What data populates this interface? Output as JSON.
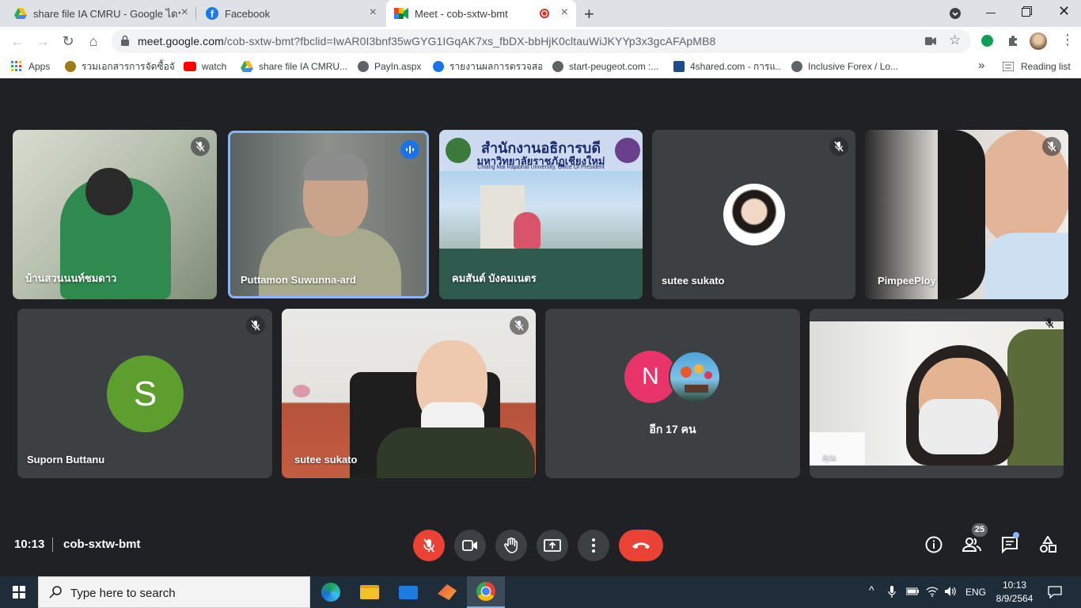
{
  "browser": {
    "tabs": [
      {
        "title": "share file IA CMRU - Google ไดรฟ์",
        "close": "×"
      },
      {
        "title": "Facebook",
        "close": "×"
      },
      {
        "title": "Meet - cob-sxtw-bmt",
        "close": "×"
      }
    ],
    "new_tab": "+",
    "url_domain": "meet.google.com",
    "url_path": "/cob-sxtw-bmt?fbclid=IwAR0I3bnf35wGYG1IGqAK7xs_fbDX-bbHjK0cltauWiJKYYp3x3gcAFApMB8",
    "bookmarks": [
      {
        "label": "Apps",
        "color": "#4285f4"
      },
      {
        "label": "รวมเอกสารการจัดซื้อจั...",
        "color": "#9e7b17"
      },
      {
        "label": "watch",
        "color": "#ff0000"
      },
      {
        "label": "share file IA CMRU...",
        "color": "#34a853"
      },
      {
        "label": "PayIn.aspx",
        "color": "#5f6368"
      },
      {
        "label": "รายงานผลการตรวจสอ...",
        "color": "#1a73e8"
      },
      {
        "label": "start-peugeot.com :...",
        "color": "#5f6368"
      },
      {
        "label": "4shared.com - การแ...",
        "color": "#1c4d8a"
      },
      {
        "label": "Inclusive Forex / Lo...",
        "color": "#5f6368"
      }
    ],
    "more_bookmarks": "»",
    "reading_list": "Reading list"
  },
  "participants": [
    {
      "name": "บ้านสวนนนท์ชมดาว",
      "muted": true
    },
    {
      "name": "Puttamon Suwunna-ard",
      "speaking": true
    },
    {
      "name": "คมสันต์ บังคมเนตร",
      "muted": false,
      "banner_title": "สำนักงานอธิการบดี",
      "banner_subtitle": "มหาวิทยาลัยราชภัฏเชียงใหม่",
      "banner_caption": "Chiang Mai Rajabhat University, Office Of President"
    },
    {
      "name": "sutee sukato",
      "muted": true
    },
    {
      "name": "PimpeePloy",
      "muted": true
    },
    {
      "name": "Suporn Buttanu",
      "muted": true,
      "initial": "S",
      "avatar_color": "#5e9e2f"
    },
    {
      "name": "sutee sukato",
      "muted": true
    },
    {
      "name": "",
      "group_initial": "N",
      "group_color": "#e8336b",
      "more_label": "อีก 17 คน"
    },
    {
      "name": "คุณ",
      "muted": true
    }
  ],
  "meeting": {
    "time": "10:13",
    "code": "cob-sxtw-bmt",
    "people_count": "25"
  },
  "taskbar": {
    "search_placeholder": "Type here to search",
    "language": "ENG",
    "clock_time": "10:13",
    "clock_date": "8/9/2564"
  }
}
